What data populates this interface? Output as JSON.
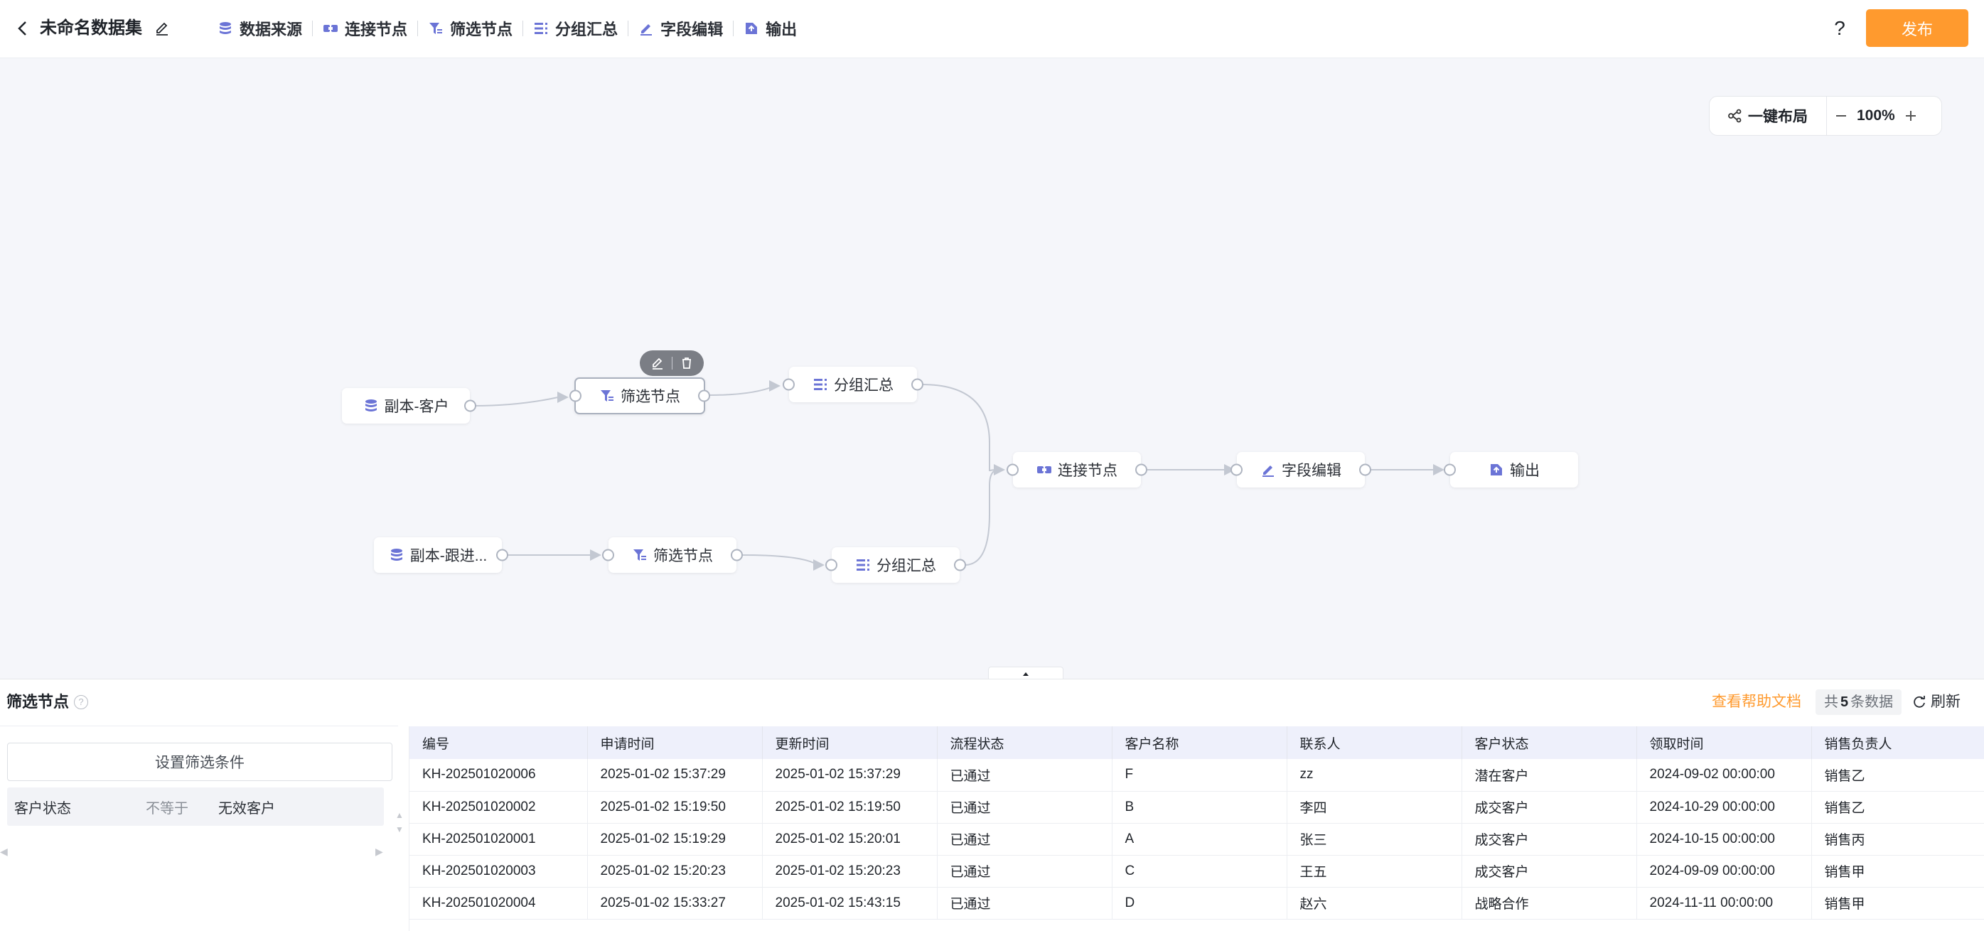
{
  "header": {
    "title": "未命名数据集",
    "tools": [
      {
        "key": "datasource",
        "label": "数据来源",
        "icon": "database-icon"
      },
      {
        "key": "join",
        "label": "连接节点",
        "icon": "join-icon"
      },
      {
        "key": "filter",
        "label": "筛选节点",
        "icon": "filter-icon"
      },
      {
        "key": "group",
        "label": "分组汇总",
        "icon": "group-icon"
      },
      {
        "key": "field",
        "label": "字段编辑",
        "icon": "pen-icon"
      },
      {
        "key": "output",
        "label": "输出",
        "icon": "output-icon"
      }
    ],
    "help": "?",
    "publish": "发布"
  },
  "canvas": {
    "layout_label": "一键布局",
    "zoom": "100%",
    "nodes": {
      "source1": "副本-客户",
      "filter1": "筛选节点",
      "group1": "分组汇总",
      "join": "连接节点",
      "field": "字段编辑",
      "output": "输出",
      "source2": "副本-跟进...",
      "filter2": "筛选节点",
      "group2": "分组汇总"
    }
  },
  "panel": {
    "title": "筛选节点",
    "doc_link": "查看帮助文档",
    "count_prefix": "共",
    "count": "5",
    "count_suffix": "条数据",
    "refresh": "刷新",
    "set_filter": "设置筛选条件",
    "condition": {
      "field": "客户状态",
      "operator": "不等于",
      "value": "无效客户"
    },
    "table": {
      "columns": [
        "编号",
        "申请时间",
        "更新时间",
        "流程状态",
        "客户名称",
        "联系人",
        "客户状态",
        "领取时间",
        "销售负责人"
      ],
      "rows": [
        [
          "KH-202501020006",
          "2025-01-02 15:37:29",
          "2025-01-02 15:37:29",
          "已通过",
          "F",
          "zz",
          "潜在客户",
          "2024-09-02 00:00:00",
          "销售乙"
        ],
        [
          "KH-202501020002",
          "2025-01-02 15:19:50",
          "2025-01-02 15:19:50",
          "已通过",
          "B",
          "李四",
          "成交客户",
          "2024-10-29 00:00:00",
          "销售乙"
        ],
        [
          "KH-202501020001",
          "2025-01-02 15:19:29",
          "2025-01-02 15:20:01",
          "已通过",
          "A",
          "张三",
          "成交客户",
          "2024-10-15 00:00:00",
          "销售丙"
        ],
        [
          "KH-202501020003",
          "2025-01-02 15:20:23",
          "2025-01-02 15:20:23",
          "已通过",
          "C",
          "王五",
          "成交客户",
          "2024-09-09 00:00:00",
          "销售甲"
        ],
        [
          "KH-202501020004",
          "2025-01-02 15:33:27",
          "2025-01-02 15:43:15",
          "已通过",
          "D",
          "赵六",
          "战略合作",
          "2024-11-11 00:00:00",
          "销售甲"
        ]
      ]
    }
  },
  "colors": {
    "accent": "#ff9a2e",
    "icon": "#6b74d6",
    "header_bg": "#eef0fb"
  }
}
